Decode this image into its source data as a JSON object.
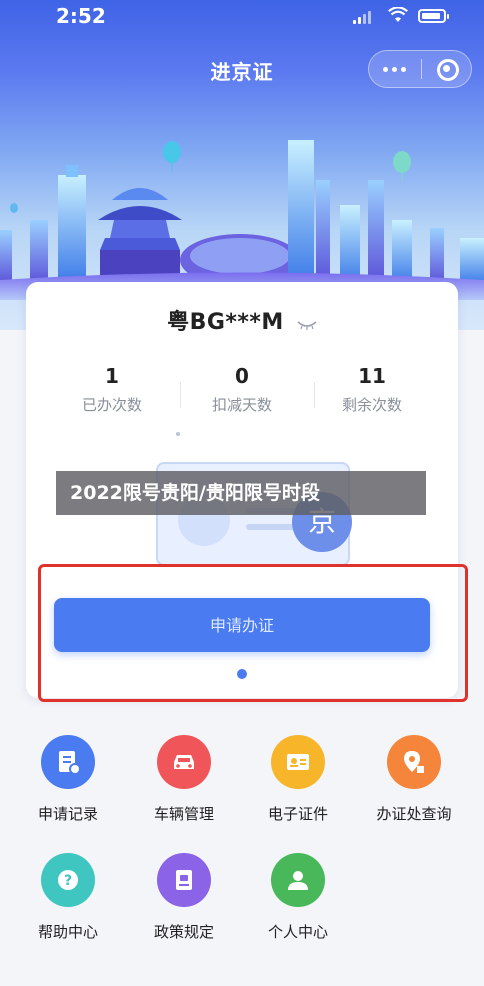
{
  "status_bar": {
    "time": "2:52"
  },
  "nav": {
    "title": "进京证"
  },
  "card": {
    "plate": "粤BG***M",
    "stats": [
      {
        "value": "1",
        "label": "已办次数"
      },
      {
        "value": "0",
        "label": "扣减天数"
      },
      {
        "value": "11",
        "label": "剩余次数"
      }
    ],
    "jing_char": "京",
    "apply_label": "申请办证"
  },
  "banner": {
    "text": "2022限号贵阳/贵阳限号时段"
  },
  "menu": {
    "items": [
      {
        "label": "申请记录",
        "icon": "application-record-icon",
        "color": "#4a7bf0"
      },
      {
        "label": "车辆管理",
        "icon": "car-icon",
        "color": "#f0555a"
      },
      {
        "label": "电子证件",
        "icon": "id-card-icon",
        "color": "#f7b52a"
      },
      {
        "label": "办证处查询",
        "icon": "location-icon",
        "color": "#f4853a"
      },
      {
        "label": "帮助中心",
        "icon": "help-icon",
        "color": "#3fc6c0"
      },
      {
        "label": "政策规定",
        "icon": "policy-book-icon",
        "color": "#8a63e6"
      },
      {
        "label": "个人中心",
        "icon": "user-icon",
        "color": "#49b85a"
      }
    ]
  },
  "colors": {
    "accent": "#4a7bf0",
    "highlight": "#e0322d"
  }
}
